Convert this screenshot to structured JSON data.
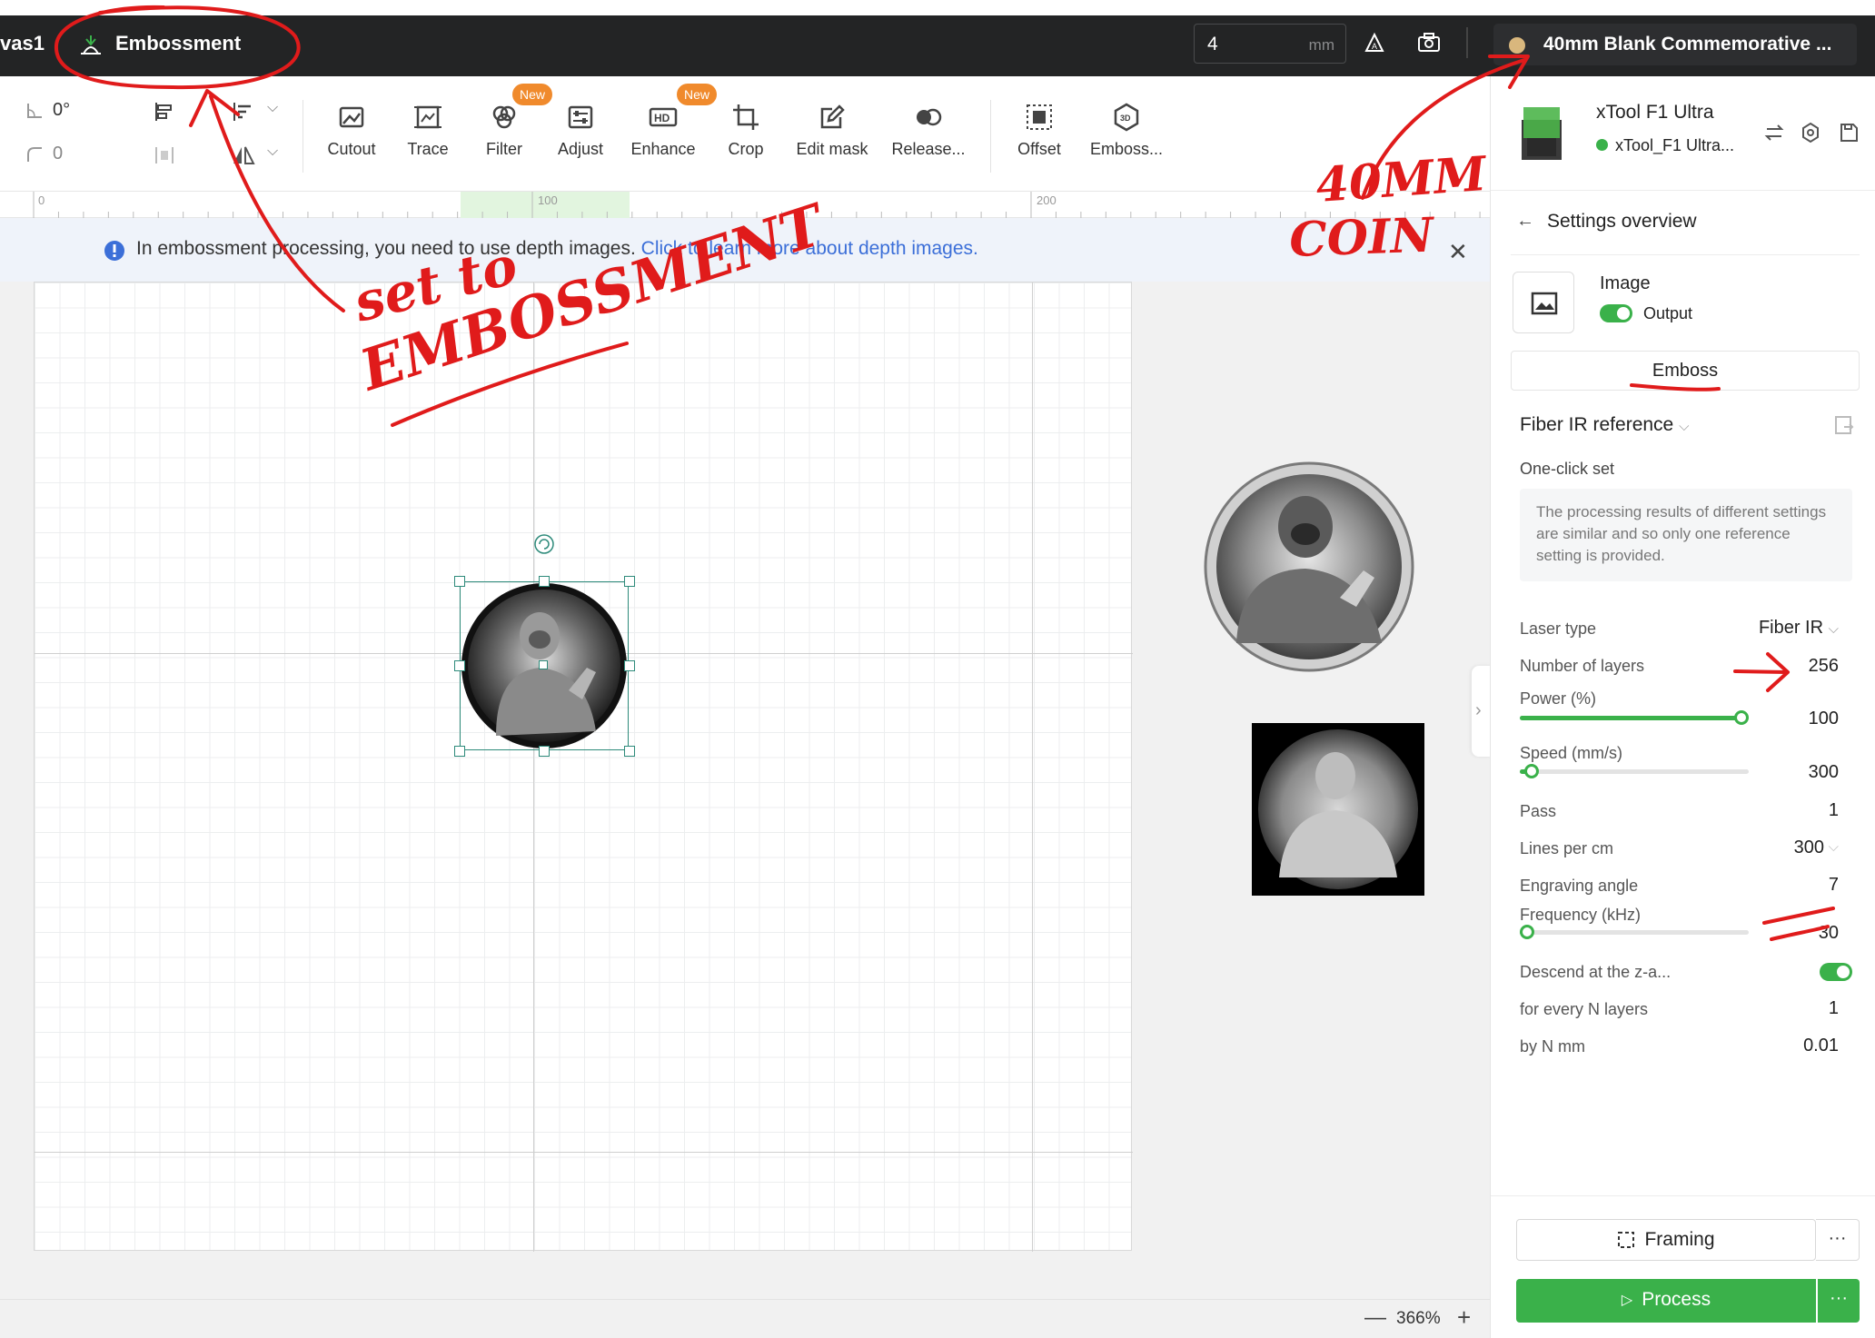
{
  "topbar": {
    "canvas_tab": "vas1",
    "active_tab": "Embossment",
    "thickness_value": "4",
    "thickness_unit": "mm",
    "material": "40mm Blank Commemorative ..."
  },
  "toolbar": {
    "rotation": "0°",
    "corner_radius": "0",
    "tools": [
      {
        "label": "Cutout",
        "icon": "cutout-icon"
      },
      {
        "label": "Trace",
        "icon": "trace-icon"
      },
      {
        "label": "Filter",
        "icon": "filter-icon",
        "badge": "New"
      },
      {
        "label": "Adjust",
        "icon": "adjust-icon"
      },
      {
        "label": "Enhance",
        "icon": "hd-enhance-icon",
        "badge": "New"
      },
      {
        "label": "Crop",
        "icon": "crop-icon"
      },
      {
        "label": "Edit mask",
        "icon": "edit-mask-icon"
      },
      {
        "label": "Release...",
        "icon": "release-icon"
      },
      {
        "label": "Offset",
        "icon": "offset-icon"
      },
      {
        "label": "Emboss...",
        "icon": "emboss-3d-icon"
      }
    ]
  },
  "ruler": {
    "labels": [
      "0",
      "100",
      "200"
    ]
  },
  "banner": {
    "text": "In embossment processing, you need to use depth images.",
    "link": "Click to learn more about depth images."
  },
  "statusbar": {
    "zoom": "366%",
    "minus": "—",
    "plus": "+"
  },
  "panel": {
    "machine_name": "xTool F1 Ultra",
    "machine_connection": "xTool_F1 Ultra...",
    "header": "Settings overview",
    "layer_title": "Image",
    "output_label": "Output",
    "mode_tab": "Emboss",
    "reference": "Fiber IR reference",
    "one_click": "One-click set",
    "note": "The processing results of different settings are similar and so only one reference setting is provided.",
    "params": {
      "laser_type": {
        "label": "Laser type",
        "value": "Fiber IR"
      },
      "layers": {
        "label": "Number of layers",
        "value": "256"
      },
      "power": {
        "label": "Power (%)",
        "value": "100",
        "level": 1.0
      },
      "speed": {
        "label": "Speed (mm/s)",
        "value": "300",
        "level": 0.02
      },
      "pass": {
        "label": "Pass",
        "value": "1"
      },
      "lines": {
        "label": "Lines per cm",
        "value": "300"
      },
      "angle": {
        "label": "Engraving angle",
        "value": "7"
      },
      "frequency": {
        "label": "Frequency (kHz)",
        "value": "30",
        "level": 0.0
      },
      "descend": {
        "label": "Descend at the z-a...",
        "enabled": true
      },
      "every_n": {
        "label": "for every N layers",
        "value": "1"
      },
      "by_n": {
        "label": "by N mm",
        "value": "0.01"
      }
    },
    "framing_label": "Framing",
    "process_label": "Process",
    "more": "···"
  },
  "colors": {
    "accent": "#3ab14a",
    "annotation": "#e01b1b",
    "topbar": "#232425"
  },
  "annotations": {
    "note1_line1": "set to",
    "note1_line2": "EMBOSSMENT",
    "note2_line1": "40MM",
    "note2_line2": "COIN"
  }
}
